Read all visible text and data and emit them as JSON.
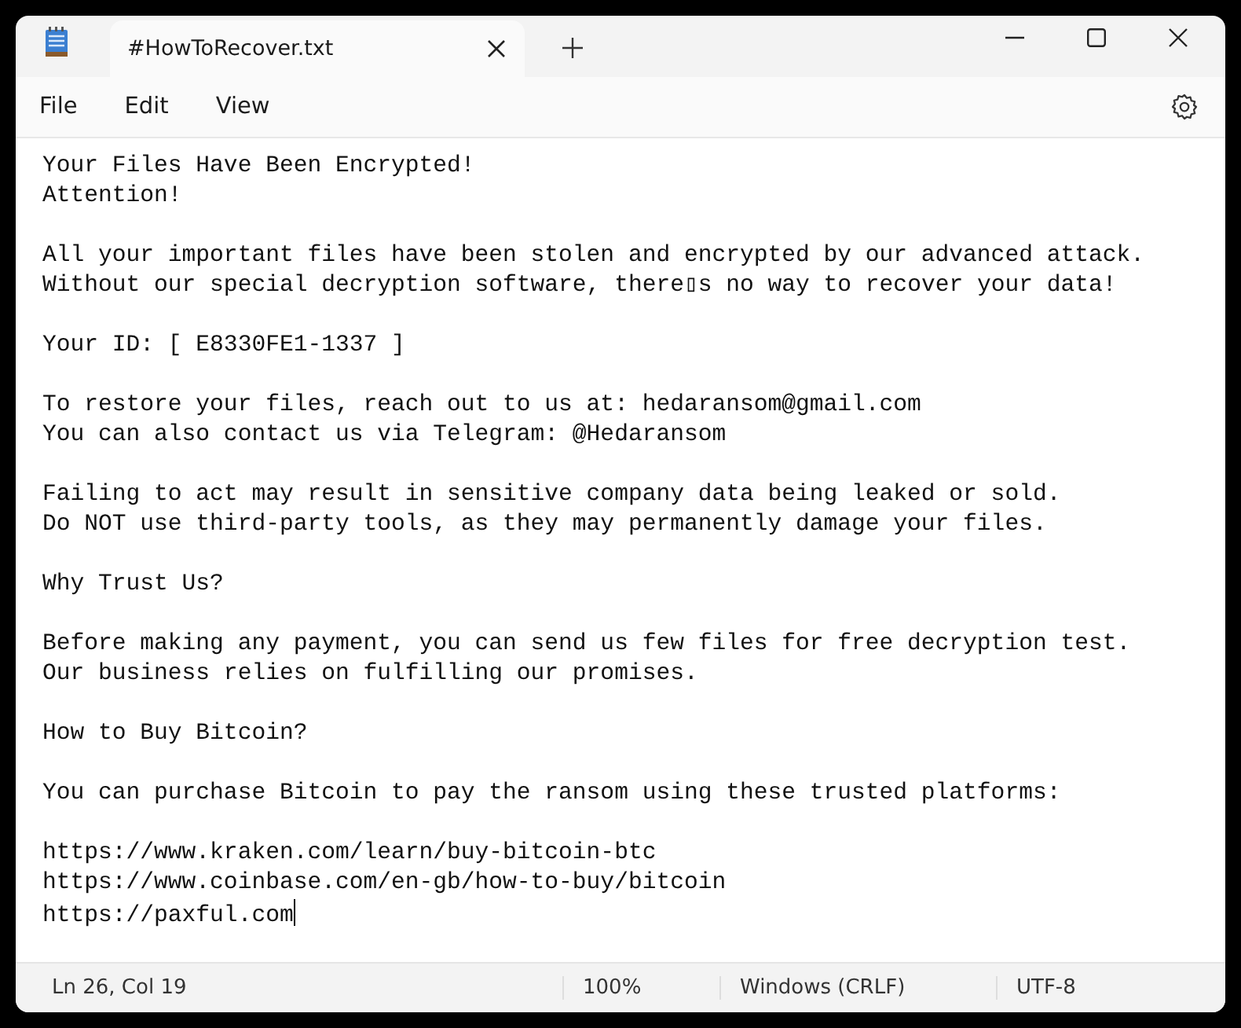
{
  "window": {
    "tab_title": "#HowToRecover.txt"
  },
  "menu": [
    "File",
    "Edit",
    "View"
  ],
  "paragraphs": [
    [
      "Your Files Have Been Encrypted!",
      "Attention!"
    ],
    [
      "All your important files have been stolen and encrypted by our advanced attack.",
      "Without our special decryption software, there▯s no way to recover your data!"
    ],
    [
      "Your ID: [ E8330FE1-1337 ]"
    ],
    [
      "To restore your files, reach out to us at: hedaransom@gmail.com",
      "You can also contact us via Telegram: @Hedaransom"
    ],
    [
      "Failing to act may result in sensitive company data being leaked or sold.",
      "Do NOT use third-party tools, as they may permanently damage your files."
    ],
    [
      "Why Trust Us?"
    ],
    [
      "Before making any payment, you can send us few files for free decryption test.",
      "Our business relies on fulfilling our promises."
    ],
    [
      "How to Buy Bitcoin?"
    ],
    [
      "You can purchase Bitcoin to pay the ransom using these trusted platforms:"
    ],
    [
      "https://www.kraken.com/learn/buy-bitcoin-btc",
      "https://www.coinbase.com/en-gb/how-to-buy/bitcoin",
      "https://paxful.com"
    ]
  ],
  "status_bar": {
    "position": "Ln 26, Col 19",
    "zoom": "100%",
    "line_endings": "Windows (CRLF)",
    "encoding": "UTF-8"
  }
}
